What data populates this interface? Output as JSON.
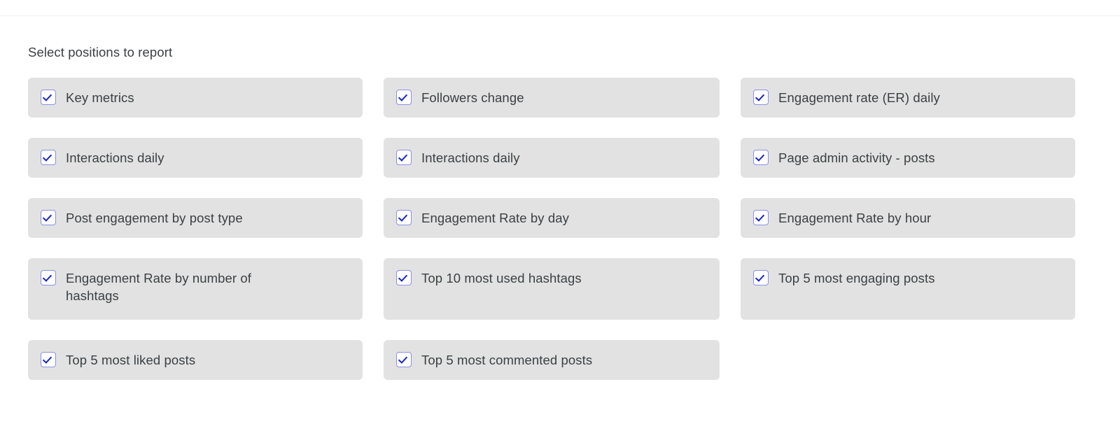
{
  "section": {
    "title": "Select positions to report"
  },
  "checkbox": {
    "icon": "checkmark-icon",
    "checked_color": "#1a27c9",
    "border_color": "#8c8fe8",
    "box_fill": "#ffffff"
  },
  "colors": {
    "page_background": "#ffffff",
    "card_background": "#e2e2e2",
    "text": "#3c4043",
    "divider": "#eceef0"
  },
  "grid": {
    "columns": 3,
    "rows": [
      {
        "tall": false,
        "cards": [
          {
            "label": "Key metrics",
            "checked": true
          },
          {
            "label": "Followers change",
            "checked": true
          },
          {
            "label": "Engagement rate (ER) daily",
            "checked": true
          }
        ]
      },
      {
        "tall": false,
        "cards": [
          {
            "label": "Interactions daily",
            "checked": true
          },
          {
            "label": "Interactions daily",
            "checked": true
          },
          {
            "label": "Page admin activity - posts",
            "checked": true
          }
        ]
      },
      {
        "tall": false,
        "cards": [
          {
            "label": "Post engagement by post type",
            "checked": true
          },
          {
            "label": "Engagement Rate by day",
            "checked": true
          },
          {
            "label": "Engagement Rate by hour",
            "checked": true
          }
        ]
      },
      {
        "tall": true,
        "cards": [
          {
            "label": "Engagement Rate by number of hashtags",
            "checked": true
          },
          {
            "label": "Top 10 most used hashtags",
            "checked": true
          },
          {
            "label": "Top 5 most engaging posts",
            "checked": true
          }
        ]
      },
      {
        "tall": false,
        "cards": [
          {
            "label": "Top 5 most liked posts",
            "checked": true
          },
          {
            "label": "Top 5 most commented posts",
            "checked": true
          }
        ]
      }
    ]
  }
}
